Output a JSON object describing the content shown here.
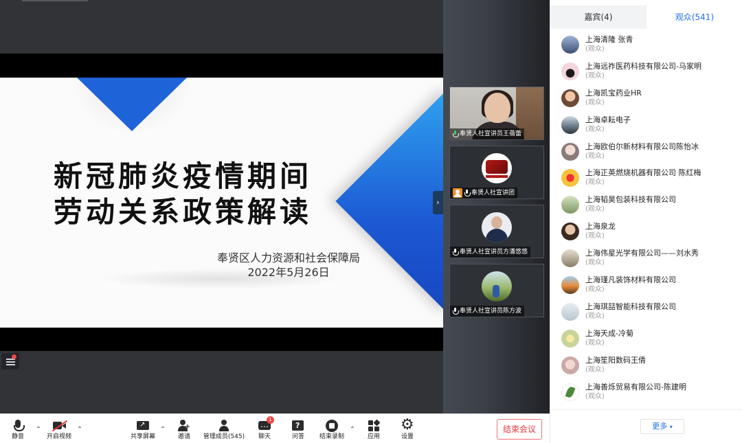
{
  "slide": {
    "title_line1": "新冠肺炎疫情期间",
    "title_line2": "劳动关系政策解读",
    "org": "奉贤区人力资源和社会保障局",
    "date": "2022年5月26日"
  },
  "video_tiles": [
    {
      "name": "奉贤人社宣讲员王蓓蕾",
      "mic": "active"
    },
    {
      "name": "奉贤人社宣讲团",
      "mic": "on",
      "host": true
    },
    {
      "name": "奉贤人社宣讲员方潘悠悠",
      "mic": "muted"
    },
    {
      "name": "奉贤人社宣讲员陈方波",
      "mic": "muted"
    }
  ],
  "panel": {
    "tab_guests": "嘉宾(4)",
    "tab_audience": "观众(541)",
    "active_tab": "audience",
    "members": [
      {
        "name": "上海清隆 张青",
        "role": "(观众)"
      },
      {
        "name": "上海远祚医药科技有限公司-马家明",
        "role": "(观众)"
      },
      {
        "name": "上海凯宝药业HR",
        "role": "(观众)"
      },
      {
        "name": "上海卓耘电子",
        "role": "(观众)"
      },
      {
        "name": "上海欧伯尔新材料有限公司陈怡冰",
        "role": "(观众)"
      },
      {
        "name": "上海正英燃烧机器有限公司 陈红梅",
        "role": "(观众)"
      },
      {
        "name": "上海韬昊包装科技有限公司",
        "role": "(观众)"
      },
      {
        "name": "上海泉龙",
        "role": "(观众)"
      },
      {
        "name": "上海伟星光学有限公司——刘水秀",
        "role": "(观众)"
      },
      {
        "name": "上海瑾凡装饰材料有限公司",
        "role": "(观众)"
      },
      {
        "name": "上海琪喆智能科技有限公司",
        "role": "(观众)"
      },
      {
        "name": "上海天成-冷菊",
        "role": "(观众)"
      },
      {
        "name": "上海笙阳数码王倩",
        "role": "(观众)"
      },
      {
        "name": "上海善烁贸易有限公司-陈建明",
        "role": "(观众)"
      }
    ],
    "more_label": "更多"
  },
  "toolbar": {
    "mute": "静音",
    "start_video": "开启视频",
    "share_screen": "共享屏幕",
    "invite": "邀请",
    "manage_members": "管理成员(545)",
    "chat": "聊天",
    "chat_badge": "1",
    "qa": "问答",
    "stop_recording": "结束录制",
    "apps": "应用",
    "settings": "设置",
    "end_meeting": "结束会议"
  },
  "icons": {
    "mute": "microphone-icon",
    "start_video": "camera-off-icon",
    "share_screen": "share-screen-icon",
    "invite": "add-user-icon",
    "manage_members": "members-icon",
    "chat": "chat-icon",
    "qa": "question-icon",
    "stop_recording": "stop-record-icon",
    "apps": "apps-icon",
    "settings": "gear-icon"
  },
  "colors": {
    "accent": "#1f6fe5",
    "danger": "#e5363b",
    "slide_blue": "#1f63d8"
  }
}
